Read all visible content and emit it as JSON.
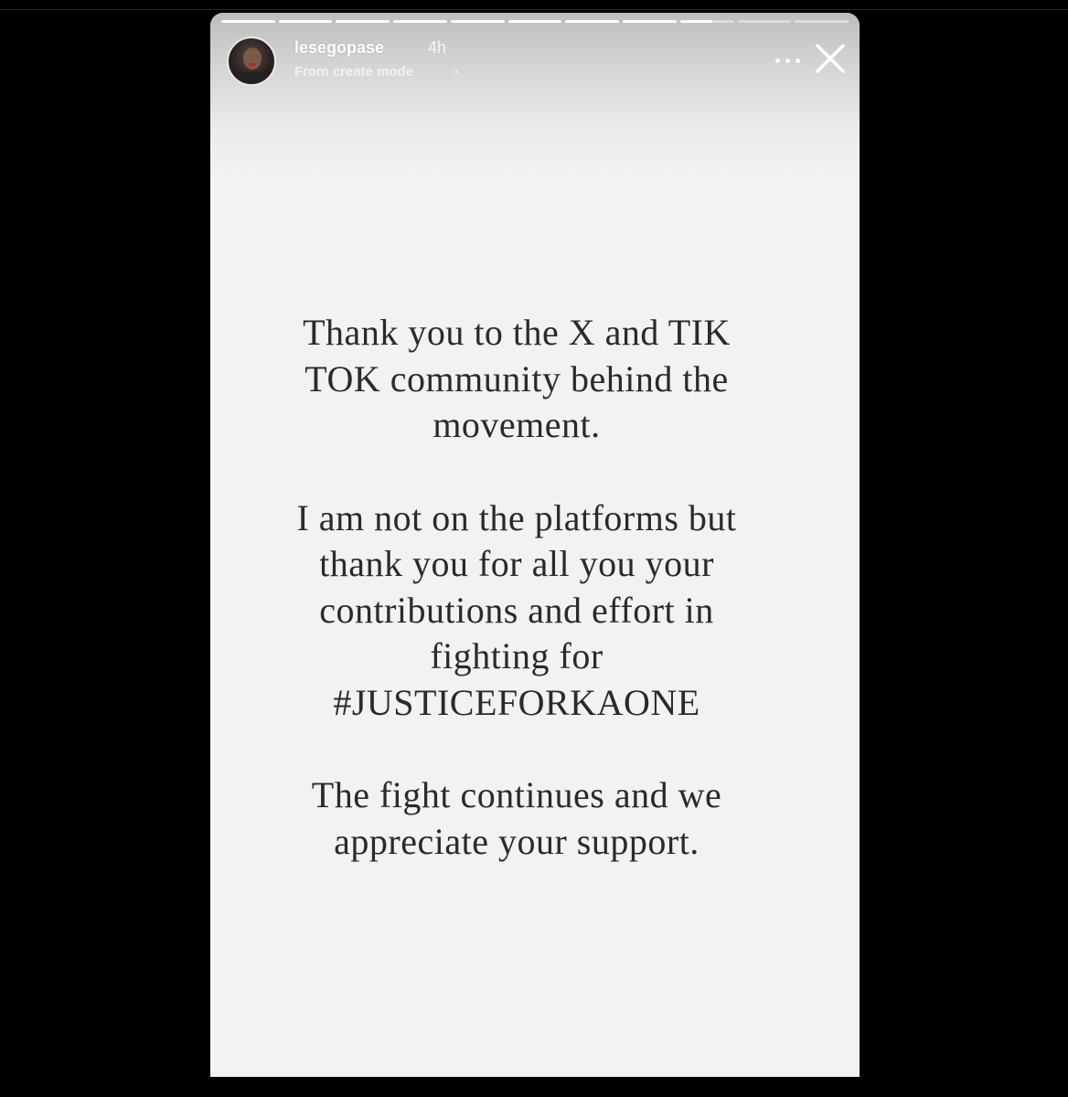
{
  "story": {
    "progress": {
      "segment_count": 11,
      "segments_complete": 8,
      "current_segment_fraction": 0.6
    },
    "header": {
      "username": "lesegopase",
      "time_ago": "4h",
      "subtitle": "From create mode",
      "subtitle_chevron": "›",
      "more_icon": "more-horizontal-icon",
      "close_icon": "close-icon"
    },
    "message": {
      "paragraph_1": {
        "line_1": "Thank you to the X and TIK",
        "line_2": "TOK community behind the",
        "line_3": "movement."
      },
      "paragraph_2": {
        "line_1": "I am not on the platforms but",
        "line_2": "thank you for all you your",
        "line_3": "contributions and effort in",
        "line_4": "fighting for",
        "line_5": "#JUSTICEFORKAONE"
      },
      "paragraph_3": {
        "line_1": "The fight continues and we",
        "line_2": "appreciate your support."
      }
    }
  },
  "colors": {
    "background": "#000000",
    "story_background": "#f2f2f2",
    "text": "#2a2a2a",
    "header_text": "#ffffff"
  }
}
